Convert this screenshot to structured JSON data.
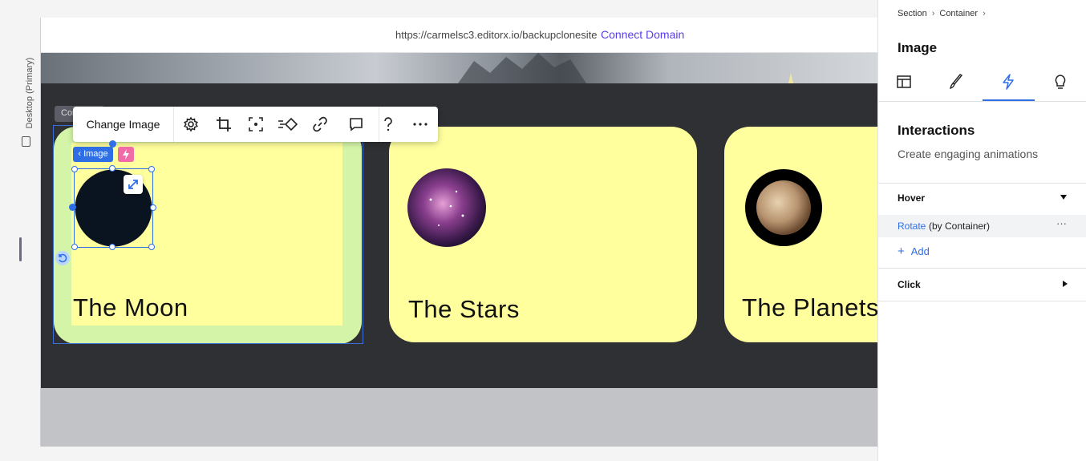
{
  "device": {
    "label": "Desktop (Primary)"
  },
  "urlbar": {
    "url": "https://carmelsc3.editorx.io/backupclonesite",
    "connect_label": "Connect Domain"
  },
  "cards": [
    {
      "title": "The Moon"
    },
    {
      "title": "The Stars"
    },
    {
      "title": "The Planets"
    }
  ],
  "toolbar": {
    "change_image_label": "Change Image",
    "icons": [
      "settings-icon",
      "crop-icon",
      "focal-point-icon",
      "animation-icon",
      "link-icon",
      "comment-icon",
      "help-icon",
      "more-icon"
    ]
  },
  "selection": {
    "container_tab": "Con",
    "image_tag": "‹ Image"
  },
  "panel": {
    "breadcrumb": [
      "Section",
      "Container"
    ],
    "title": "Image",
    "tabs": [
      "layout-icon",
      "design-icon",
      "interactions-icon",
      "ideas-icon"
    ],
    "active_tab": "interactions-icon",
    "interactions_title": "Interactions",
    "interactions_subtitle": "Create engaging animations",
    "hover_label": "Hover",
    "rotate_link": "Rotate",
    "rotate_rest": "(by Container)",
    "rotate_more": "···",
    "add_label": "Add",
    "click_label": "Click"
  },
  "colors": {
    "accent": "#2f6fe6",
    "card": "#ffff9e",
    "selected_card": "#d4f5a8",
    "section": "#2f3033",
    "connect": "#5a3de8"
  }
}
